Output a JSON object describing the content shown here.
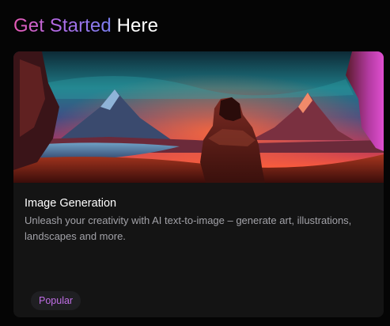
{
  "header": {
    "title_highlight": "Get Started",
    "title_rest": "Here"
  },
  "card": {
    "image_alt": "Hooded figure overlooking a lake and mountains under a colorful sky",
    "title": "Image Generation",
    "description": "Unleash your creativity with AI text-to-image – generate art, illustrations, landscapes and more.",
    "badge": "Popular"
  },
  "colors": {
    "page_background": "#050505",
    "card_background": "#141414",
    "gradient_start": "#e65ab3",
    "gradient_end": "#7b7ff0",
    "badge_text": "#c06ee6"
  }
}
